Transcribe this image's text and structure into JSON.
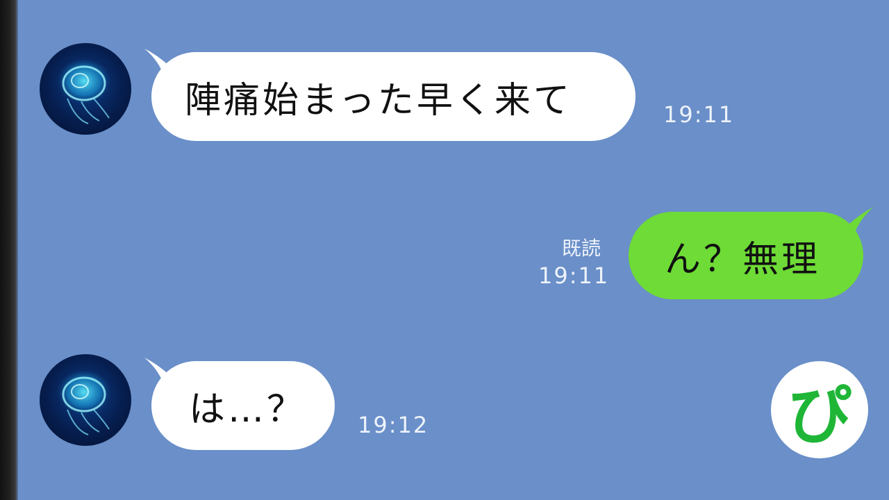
{
  "messages": [
    {
      "direction": "incoming",
      "text": "陣痛始まった早く来て",
      "time": "19:11",
      "avatar_icon": "jellyfish-avatar-icon"
    },
    {
      "direction": "outgoing",
      "text": "ん？無理",
      "time": "19:11",
      "read_label": "既読"
    },
    {
      "direction": "incoming",
      "text": "は…？",
      "time": "19:12",
      "avatar_icon": "jellyfish-avatar-icon"
    }
  ],
  "badge": {
    "text": "ぴ"
  },
  "colors": {
    "background": "#6a8fc9",
    "incoming_bubble": "#ffffff",
    "outgoing_bubble": "#6edb36",
    "badge_text": "#1fb637"
  }
}
